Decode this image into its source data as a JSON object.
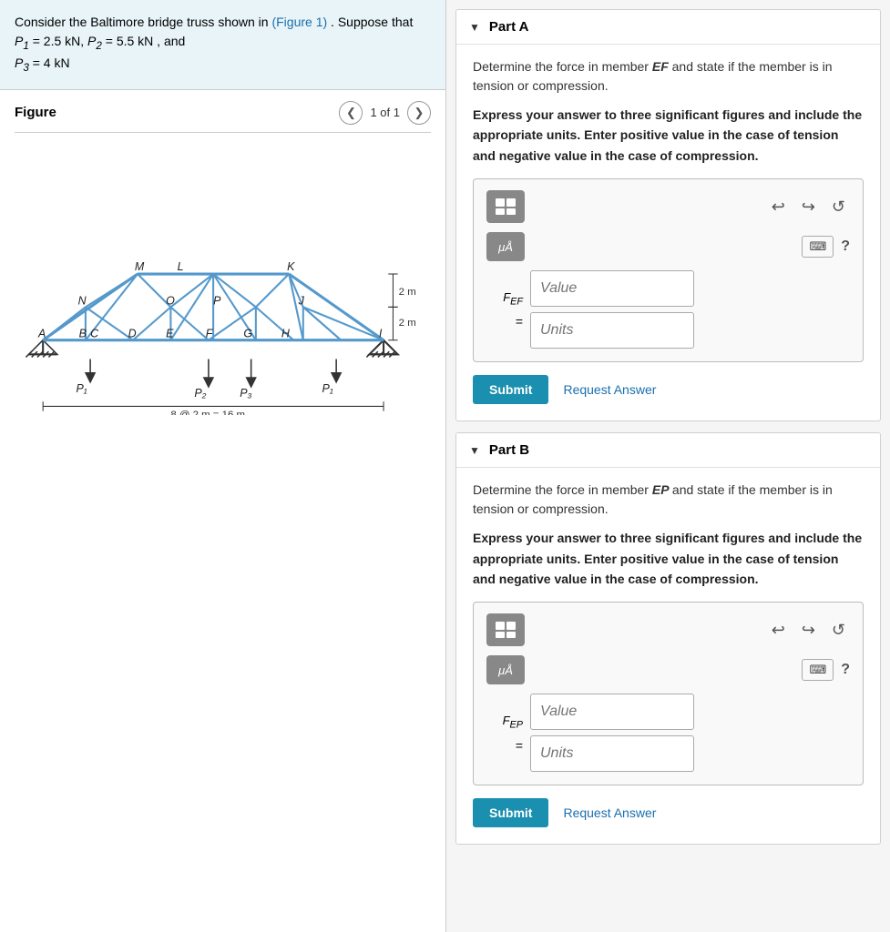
{
  "left": {
    "problem_text_1": "Consider the Baltimore bridge truss shown in",
    "figure_link": "(Figure 1)",
    "problem_text_2": ". Suppose that",
    "p1_label": "P",
    "p1_sub": "1",
    "p1_val": "= 2.5 kN,",
    "p2_label": "P",
    "p2_sub": "2",
    "p2_val": "= 5.5 kN",
    "problem_text_3": ", and",
    "p3_label": "P",
    "p3_sub": "3",
    "p3_val": "= 4 kN",
    "problem_text_4": ".",
    "figure_title": "Figure",
    "nav_count": "1 of 1"
  },
  "parts": [
    {
      "id": "part-a",
      "title": "Part A",
      "description_1": "Determine the force in member",
      "member": "EF",
      "description_2": "and state if the member is in tension or compression.",
      "instructions": "Express your answer to three significant figures and include the appropriate units. Enter positive value in the case of tension and negative value in the case of compression.",
      "input_label": "F",
      "input_sub": "EF",
      "value_placeholder": "Value",
      "units_placeholder": "Units",
      "submit_label": "Submit",
      "request_label": "Request Answer"
    },
    {
      "id": "part-b",
      "title": "Part B",
      "description_1": "Determine the force in member",
      "member": "EP",
      "description_2": "and state if the member is in tension or compression.",
      "instructions": "Express your answer to three significant figures and include the appropriate units. Enter positive value in the case of tension and negative value in the case of compression.",
      "input_label": "F",
      "input_sub": "EP",
      "value_placeholder": "Value",
      "units_placeholder": "Units",
      "submit_label": "Submit",
      "request_label": "Request Answer"
    }
  ],
  "icons": {
    "undo": "↩",
    "redo": "↪",
    "refresh": "↺",
    "question": "?",
    "prev": "❮",
    "next": "❯",
    "mu_label": "μÅ",
    "keyboard": "⌨"
  },
  "colors": {
    "submit_bg": "#1a8faf",
    "link": "#1a6faf",
    "problem_bg": "#e8f4f8",
    "toolbar_btn": "#888888"
  }
}
